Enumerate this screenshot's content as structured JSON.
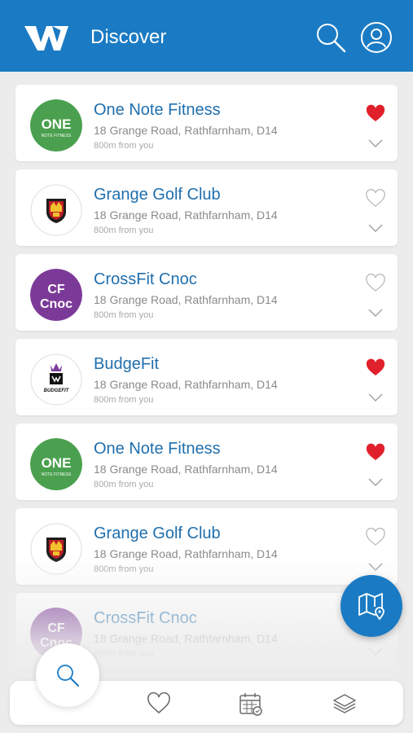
{
  "header": {
    "title": "Discover",
    "logo": "W",
    "icons": [
      "search-icon",
      "profile-icon"
    ]
  },
  "colors": {
    "brand": "#1a7bc4",
    "name": "#1f6fae",
    "favorite": "#e0202b"
  },
  "venues": [
    {
      "name": "One Note Fitness",
      "address": "18 Grange Road, Rathfarnham, D14",
      "distance": "800m from you",
      "favorite": true,
      "logo": "onf",
      "logo_text": "ONE",
      "logo_sub": "NOTE FITNESS"
    },
    {
      "name": "Grange Golf Club",
      "address": "18 Grange Road, Rathfarnham, D14",
      "distance": "800m from you",
      "favorite": false,
      "logo": "ggc"
    },
    {
      "name": "CrossFit Cnoc",
      "address": "18 Grange Road, Rathfarnham, D14",
      "distance": "800m from you",
      "favorite": false,
      "logo": "cf",
      "logo_text": "CF",
      "logo_sub": "Cnoc"
    },
    {
      "name": "BudgeFit",
      "address": "18 Grange Road, Rathfarnham, D14",
      "distance": "800m from you",
      "favorite": true,
      "logo": "bf",
      "logo_text": "BUDGEFIT"
    },
    {
      "name": "One Note Fitness",
      "address": "18 Grange Road, Rathfarnham, D14",
      "distance": "800m from you",
      "favorite": true,
      "logo": "onf",
      "logo_text": "ONE",
      "logo_sub": "NOTE FITNESS"
    },
    {
      "name": "Grange Golf Club",
      "address": "18 Grange Road, Rathfarnham, D14",
      "distance": "800m from you",
      "favorite": false,
      "logo": "ggc"
    },
    {
      "name": "CrossFit Cnoc",
      "address": "18 Grange Road, Rathfarnham, D14",
      "distance": "800m from you",
      "favorite": false,
      "logo": "cf",
      "logo_text": "CF",
      "logo_sub": "Cnoc"
    }
  ],
  "fab": {
    "map_icon": "map-icon",
    "search_icon": "search-icon"
  },
  "tabbar": {
    "icons": [
      "heart-icon",
      "calendar-icon",
      "layers-icon"
    ]
  }
}
